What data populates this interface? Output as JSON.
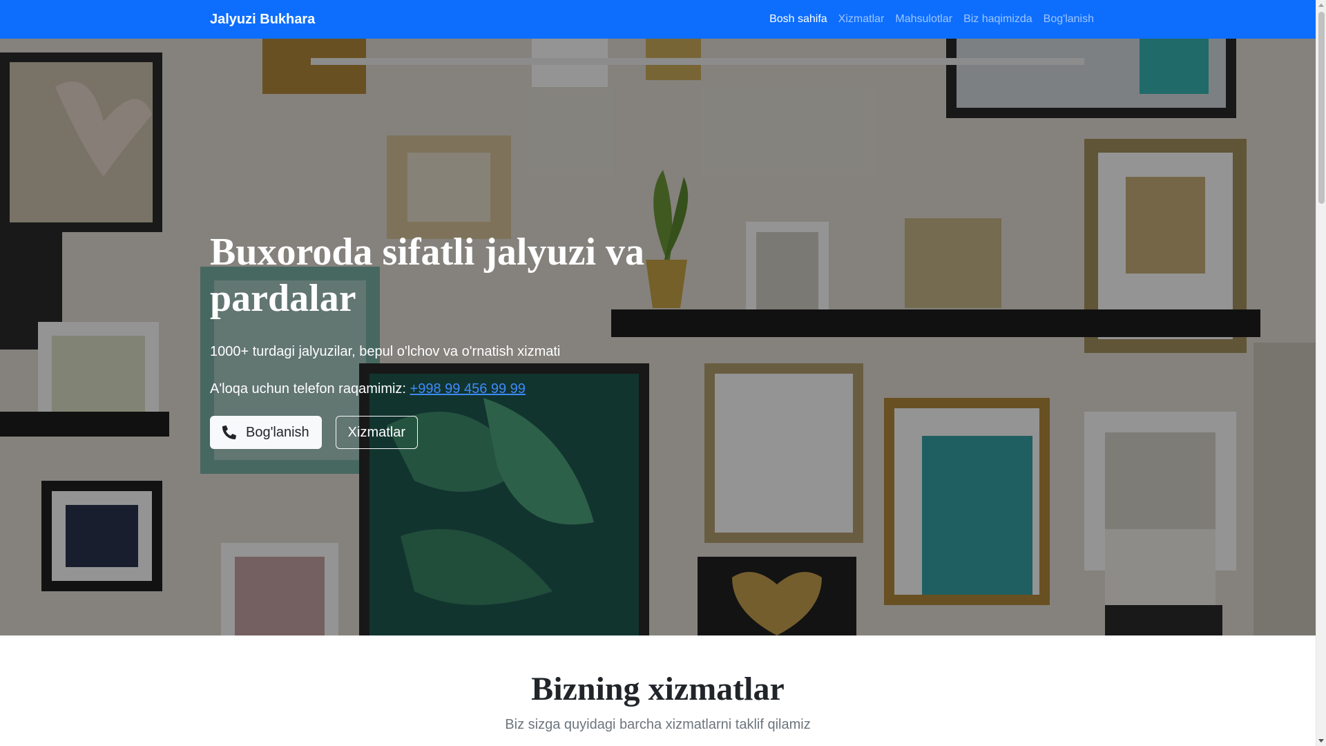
{
  "navbar": {
    "brand": "Jalyuzi Bukhara",
    "links": [
      {
        "label": "Bosh sahifa",
        "active": true
      },
      {
        "label": "Xizmatlar",
        "active": false
      },
      {
        "label": "Mahsulotlar",
        "active": false
      },
      {
        "label": "Biz haqimizda",
        "active": false
      },
      {
        "label": "Bog'lanish",
        "active": false
      }
    ],
    "background": "#0d6efd"
  },
  "hero": {
    "title": "Buxoroda sifatli jalyuzi va pardalar",
    "subtitle": "1000+ turdagi jalyuzilar, bepul o'lchov va o'rnatish xizmati",
    "phone_prefix": "A'loqa uchun telefon raqamimiz:",
    "phone": "+998 99 456 99 99",
    "contact_button": "Bog'lanish",
    "contact_icon": "phone-icon",
    "services_button": "Xizmatlar",
    "link_color": "#3d8bfd"
  },
  "services": {
    "title": "Bizning xizmatlar",
    "subtitle": "Biz sizga quyidagi barcha xizmatlarni taklif qilamiz"
  }
}
